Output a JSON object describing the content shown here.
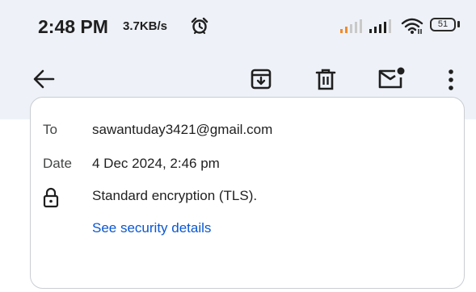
{
  "status_bar": {
    "time": "2:48 PM",
    "net_speed": "3.7KB/s",
    "battery_level": "51",
    "icons": [
      "alarm-icon",
      "cellular-signal-icon",
      "cellular-signal-icon",
      "wifi-icon",
      "battery-icon"
    ]
  },
  "toolbar": {
    "icons": [
      "back-arrow-icon",
      "archive-icon",
      "delete-icon",
      "mark-unread-icon",
      "more-options-icon"
    ]
  },
  "details": {
    "to_label": "To",
    "to_value": "sawantuday3421@gmail.com",
    "date_label": "Date",
    "date_value": "4 Dec 2024, 2:46 pm",
    "encryption_text": "Standard encryption (TLS).",
    "security_link": "See security details"
  },
  "colors": {
    "header_background": "#eef2f8",
    "link": "#0b57d0",
    "text_primary": "#1f1f1f",
    "text_secondary": "#444746"
  }
}
